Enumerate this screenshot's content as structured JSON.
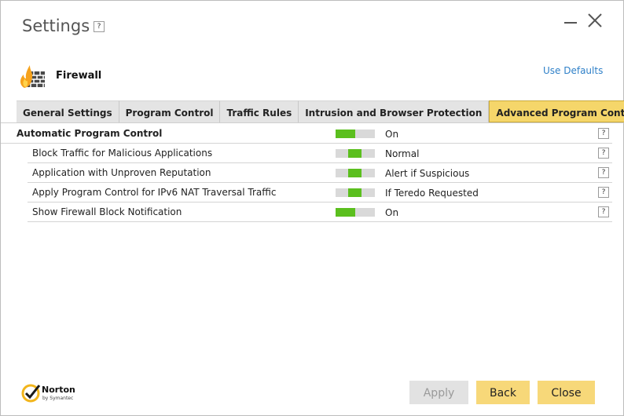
{
  "window": {
    "title": "Settings",
    "help": "?"
  },
  "section": {
    "name": "Firewall",
    "icon": "firewall-flame-icon",
    "use_defaults": "Use Defaults"
  },
  "tabs": [
    {
      "label": "General Settings",
      "active": false
    },
    {
      "label": "Program Control",
      "active": false
    },
    {
      "label": "Traffic Rules",
      "active": false
    },
    {
      "label": "Intrusion and Browser Protection",
      "active": false
    },
    {
      "label": "Advanced Program Control",
      "active": true
    }
  ],
  "rows": [
    {
      "label": "Automatic Program Control",
      "value": "On",
      "level": "on",
      "help": "?"
    },
    {
      "label": "Block Traffic for Malicious Applications",
      "value": "Normal",
      "level": "mid",
      "help": "?"
    },
    {
      "label": "Application with Unproven Reputation",
      "value": "Alert if Suspicious",
      "level": "mid",
      "help": "?"
    },
    {
      "label": "Apply Program Control for IPv6 NAT Traversal Traffic",
      "value": "If Teredo Requested",
      "level": "mid",
      "help": "?"
    },
    {
      "label": "Show Firewall Block Notification",
      "value": "On",
      "level": "on",
      "help": "?"
    }
  ],
  "footer": {
    "brand": "Norton",
    "brand_sub": "by Symantec",
    "apply": "Apply",
    "back": "Back",
    "close": "Close"
  },
  "colors": {
    "accent_button": "#f7d879",
    "active_tab": "#f5d66a",
    "slider_fill": "#5bbf1e",
    "link": "#2f80c8"
  }
}
